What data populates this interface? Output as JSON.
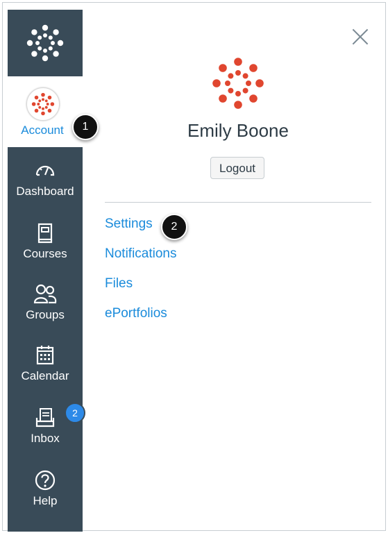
{
  "nav": {
    "account_label": "Account",
    "items": [
      {
        "label": "Dashboard",
        "icon": "dashboard-icon"
      },
      {
        "label": "Courses",
        "icon": "courses-icon"
      },
      {
        "label": "Groups",
        "icon": "groups-icon"
      },
      {
        "label": "Calendar",
        "icon": "calendar-icon"
      },
      {
        "label": "Inbox",
        "icon": "inbox-icon",
        "badge": "2"
      },
      {
        "label": "Help",
        "icon": "help-icon"
      }
    ]
  },
  "callouts": {
    "account": "1",
    "settings": "2"
  },
  "tray": {
    "user_name": "Emily Boone",
    "logout_label": "Logout",
    "links": [
      "Settings",
      "Notifications",
      "Files",
      "ePortfolios"
    ]
  },
  "colors": {
    "nav_bg": "#394b58",
    "link": "#1a8bdb",
    "brand_red": "#e0462f",
    "badge": "#2d8ae8"
  }
}
